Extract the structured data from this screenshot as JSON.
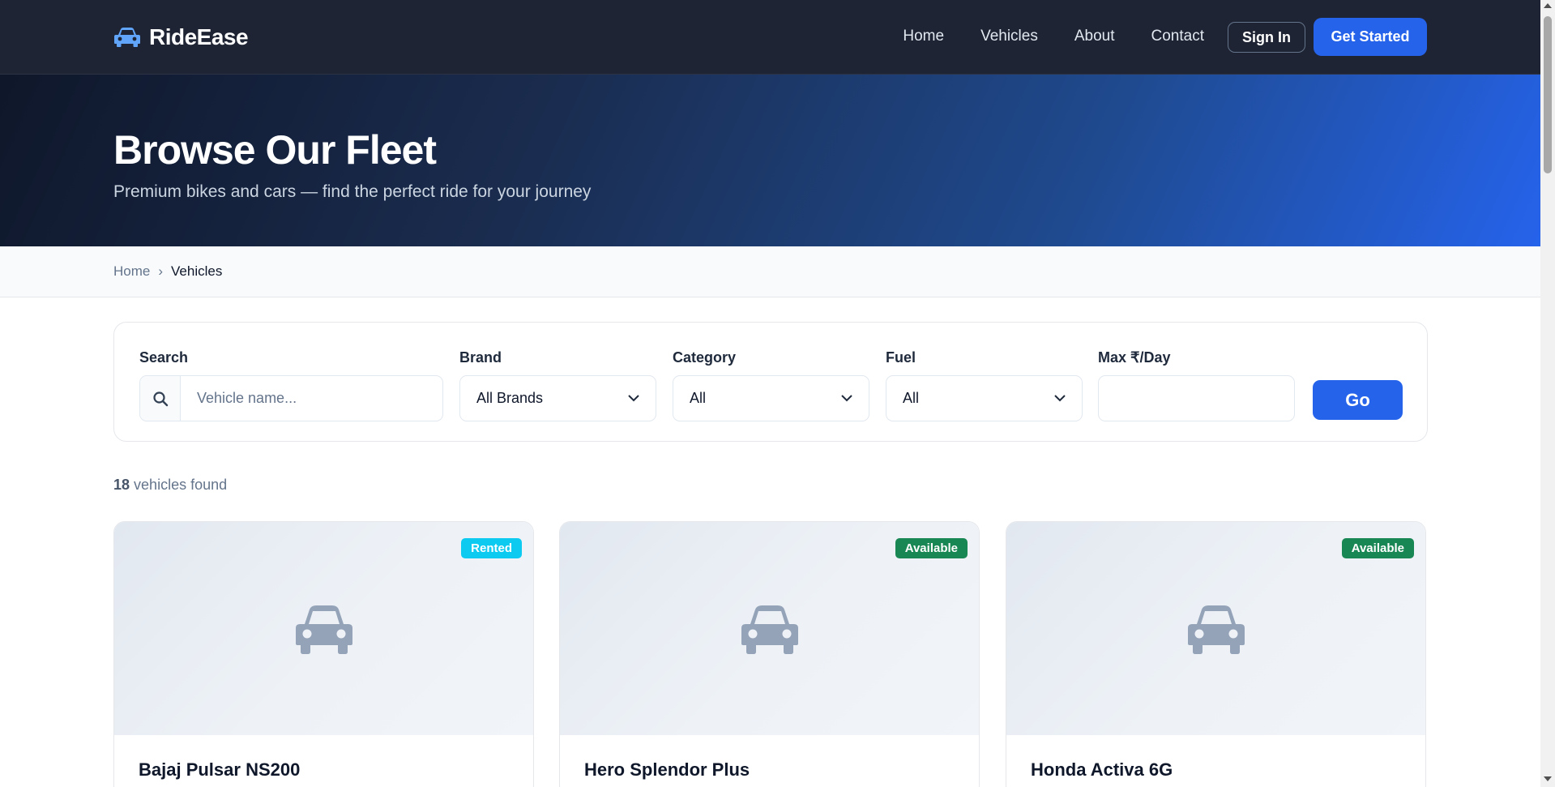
{
  "nav": {
    "brand": "RideEase",
    "links": [
      "Home",
      "Vehicles",
      "About",
      "Contact"
    ],
    "signin_label": "Sign In",
    "getstarted_label": "Get Started"
  },
  "hero": {
    "title": "Browse Our Fleet",
    "subtitle": "Premium bikes and cars — find the perfect ride for your journey"
  },
  "breadcrumb": {
    "home": "Home",
    "separator": "›",
    "current": "Vehicles"
  },
  "filters": {
    "search_label": "Search",
    "search_placeholder": "Vehicle name...",
    "search_value": "",
    "brand_label": "Brand",
    "brand_value": "All Brands",
    "category_label": "Category",
    "category_value": "All",
    "fuel_label": "Fuel",
    "fuel_value": "All",
    "price_label": "Max ₹/Day",
    "price_value": "",
    "go_label": "Go"
  },
  "results": {
    "count": "18",
    "label": "vehicles found"
  },
  "vehicles": [
    {
      "name": "Bajaj Pulsar NS200",
      "status": "Rented",
      "status_color": "#0dcaf0"
    },
    {
      "name": "Hero Splendor Plus",
      "status": "Available",
      "status_color": "#198754"
    },
    {
      "name": "Honda Activa 6G",
      "status": "Available",
      "status_color": "#198754"
    }
  ],
  "colors": {
    "navbar_bg": "#1e2433",
    "primary": "#2563eb",
    "brand_icon": "#60a5fa",
    "car_icon": "#94a3b8"
  },
  "icons": {
    "brand": "car-icon",
    "search": "search-icon",
    "select": "chevron-down-icon",
    "card_media": "car-icon"
  }
}
